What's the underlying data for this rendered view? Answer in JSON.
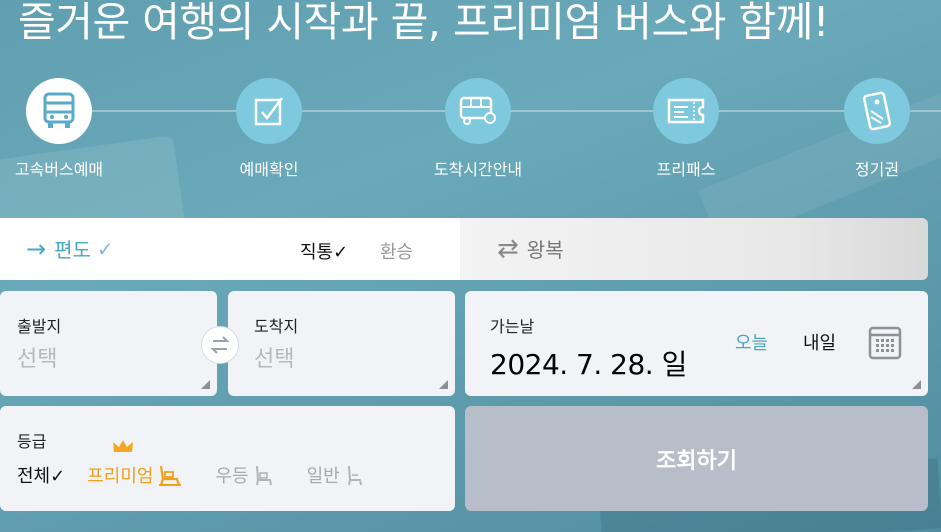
{
  "headline": "즐거운 여행의 시작과 끝, 프리미엄 버스와 함께!",
  "menu": [
    {
      "label": "고속버스예매",
      "icon": "bus-icon"
    },
    {
      "label": "예매확인",
      "icon": "checkbox-icon"
    },
    {
      "label": "도착시간안내",
      "icon": "bus-clock-icon"
    },
    {
      "label": "프리패스",
      "icon": "ticket-icon"
    },
    {
      "label": "정기권",
      "icon": "pass-card-icon"
    }
  ],
  "trip": {
    "oneway": "편도",
    "oneway_check": "✓",
    "direct": "직통✓",
    "transfer": "환승",
    "roundtrip": "왕복"
  },
  "departure": {
    "label": "출발지",
    "placeholder": "선택"
  },
  "arrival": {
    "label": "도착지",
    "placeholder": "선택"
  },
  "date": {
    "label": "가는날",
    "value": "2024. 7. 28. 일",
    "today": "오늘",
    "tomorrow": "내일"
  },
  "grade": {
    "label": "등급",
    "all": "전체",
    "all_check": "✓",
    "premium": "프리미엄",
    "excellent": "우등",
    "normal": "일반"
  },
  "search_button": "조회하기",
  "colors": {
    "accent": "#4aa6c4",
    "premium": "#f0a11a",
    "menu_circle": "#7ec9de",
    "search_button": "#b8bdca"
  }
}
